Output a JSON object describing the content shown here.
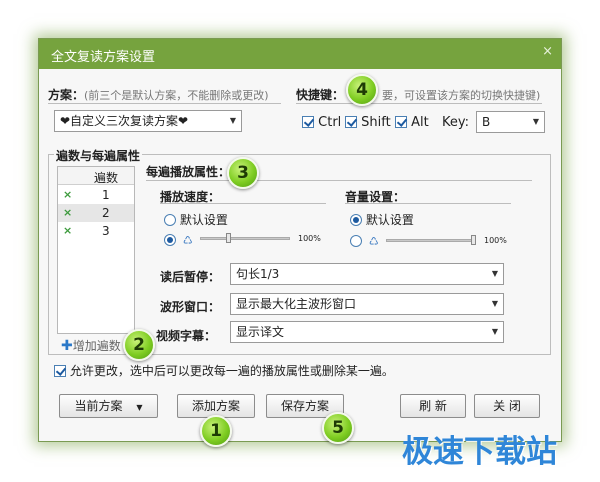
{
  "window": {
    "title": "全文复读方案设置",
    "close_glyph": "×"
  },
  "scheme": {
    "label": "方案：",
    "hint": "(前三个是默认方案，不能删除或更改)",
    "selected": "❤自定义三次复读方案❤"
  },
  "hotkey": {
    "label": "快捷键：",
    "hint": "要，可设置该方案的切换快捷键)",
    "ctrl": "Ctrl",
    "shift": "Shift",
    "alt": "Alt",
    "key_label": "Key:",
    "key_value": "B",
    "ctrl_checked": true,
    "shift_checked": true,
    "alt_checked": true
  },
  "group": {
    "title": "遍数与每遍属性",
    "table_header": "遍数",
    "rows": [
      {
        "mark": "×",
        "num": "1"
      },
      {
        "mark": "×",
        "num": "2"
      },
      {
        "mark": "×",
        "num": "3"
      }
    ],
    "add_label": "增加遍数"
  },
  "props": {
    "title": "每遍播放属性：",
    "speed_label": "播放速度：",
    "speed_default": "默认设置",
    "speed_percent": "100%",
    "speed_level": 0.3,
    "volume_label": "音量设置：",
    "volume_default": "默认设置",
    "volume_percent": "100%",
    "volume_level": 1.0,
    "pause_label": "读后暂停：",
    "pause_value": "句长1/3",
    "wave_label": "波形窗口：",
    "wave_value": "显示最大化主波形窗口",
    "subtitle_label": "视频字幕：",
    "subtitle_value": "显示译文"
  },
  "allow_change": {
    "text": "允许更改，选中后可以更改每一遍的播放属性或删除某一遍。",
    "checked": true
  },
  "buttons": {
    "current": "当前方案",
    "add": "添加方案",
    "save": "保存方案",
    "refresh": "刷 新",
    "close": "关 闭"
  },
  "badges": {
    "b1": "1",
    "b2": "2",
    "b3": "3",
    "b4": "4",
    "b5": "5"
  },
  "watermark": "极速下载站",
  "colors": {
    "title_bar": "#76a33e",
    "accent_blue": "#1d5aa0",
    "badge_green": "#7fcd22",
    "watermark": "#2f86d8"
  }
}
